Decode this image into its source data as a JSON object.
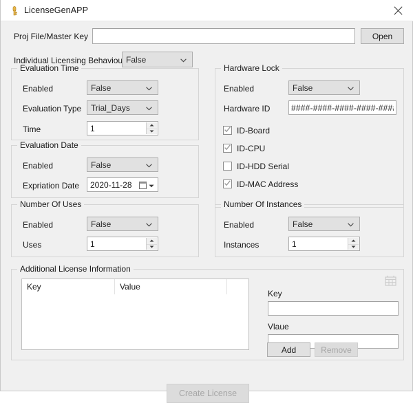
{
  "window": {
    "title": "LicenseGenAPP",
    "app_icon": "key-icon",
    "close_label": "✕"
  },
  "toolbar": {
    "proj_label": "Proj File/Master Key",
    "proj_value": "",
    "proj_placeholder": "",
    "open_label": "Open"
  },
  "individual": {
    "label": "Individual Licensing Behaviour",
    "value": "False"
  },
  "evaluation_time": {
    "title": "Evaluation Time",
    "enabled_label": "Enabled",
    "enabled_value": "False",
    "type_label": "Evaluation Type",
    "type_value": "Trial_Days",
    "time_label": "Time",
    "time_value": "1"
  },
  "evaluation_date": {
    "title": "Evaluation Date",
    "enabled_label": "Enabled",
    "enabled_value": "False",
    "expiration_label": "Expriation Date",
    "expiration_value": "2020-11-28"
  },
  "number_of_uses": {
    "title": "Number Of Uses",
    "enabled_label": "Enabled",
    "enabled_value": "False",
    "uses_label": "Uses",
    "uses_value": "1"
  },
  "hardware_lock": {
    "title": "Hardware Lock",
    "enabled_label": "Enabled",
    "enabled_value": "False",
    "hwid_label": "Hardware ID",
    "hwid_value": "####-####-####-####-####",
    "checkboxes": [
      {
        "label": "ID-Board",
        "checked": true
      },
      {
        "label": "ID-CPU",
        "checked": true
      },
      {
        "label": "ID-HDD Serial",
        "checked": false
      },
      {
        "label": "ID-MAC Address",
        "checked": true
      }
    ]
  },
  "number_of_instances": {
    "title": "Number Of Instances",
    "enabled_label": "Enabled",
    "enabled_value": "False",
    "instances_label": "Instances",
    "instances_value": "1"
  },
  "additional_info": {
    "title": "Additional License Information",
    "columns": [
      "Key",
      "Value"
    ],
    "rows": [],
    "key_label": "Key",
    "key_value": "",
    "value_label": "Vlaue",
    "value_value": "",
    "add_label": "Add",
    "remove_label": "Remove",
    "calendar_icon": "calendar-icon"
  },
  "footer": {
    "create_label": "Create License"
  },
  "colors": {
    "window_bg": "#f0f0f0",
    "field_bg": "#ffffff",
    "control_bg": "#e1e1e1",
    "border": "#adadad",
    "group_border": "#d5d5d5",
    "disabled_text": "#a6a6a6",
    "text": "#1a1a1a"
  }
}
